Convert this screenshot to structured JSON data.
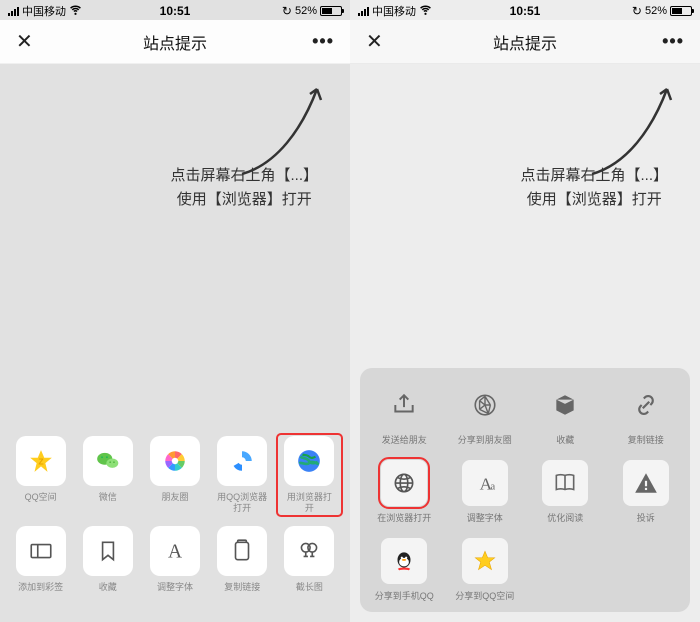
{
  "status": {
    "carrier": "中国移动",
    "time": "10:51",
    "battery": "52%"
  },
  "nav": {
    "title": "站点提示"
  },
  "instruction": {
    "line1": "点击屏幕右上角【...】",
    "line2": "使用【浏览器】打开"
  },
  "left_sheet": {
    "row1": [
      {
        "key": "qzone",
        "label": "QQ空间"
      },
      {
        "key": "wechat",
        "label": "微信"
      },
      {
        "key": "moments",
        "label": "朋友圈"
      },
      {
        "key": "qqbrowser",
        "label": "用QQ浏览器打开"
      },
      {
        "key": "browser",
        "label": "用浏览器打开",
        "highlight": true
      }
    ],
    "row2": [
      {
        "key": "bookmark",
        "label": "添加到彩签"
      },
      {
        "key": "favorite",
        "label": "收藏"
      },
      {
        "key": "font",
        "label": "调整字体"
      },
      {
        "key": "copylink",
        "label": "复制链接"
      },
      {
        "key": "longshot",
        "label": "截长图"
      }
    ]
  },
  "right_sheet": {
    "row1": [
      {
        "key": "sendfriend",
        "label": "发送给朋友"
      },
      {
        "key": "sharemoments",
        "label": "分享到朋友圈"
      },
      {
        "key": "favorite2",
        "label": "收藏"
      },
      {
        "key": "copylink2",
        "label": "复制链接"
      }
    ],
    "row2": [
      {
        "key": "openbrowser",
        "label": "在浏览器打开",
        "highlight": true
      },
      {
        "key": "adjustfont",
        "label": "调整字体"
      },
      {
        "key": "optread",
        "label": "优化阅读"
      },
      {
        "key": "complain",
        "label": "投诉"
      }
    ],
    "row3": [
      {
        "key": "shareqq",
        "label": "分享到手机QQ"
      },
      {
        "key": "shareqzone",
        "label": "分享到QQ空间"
      }
    ]
  }
}
